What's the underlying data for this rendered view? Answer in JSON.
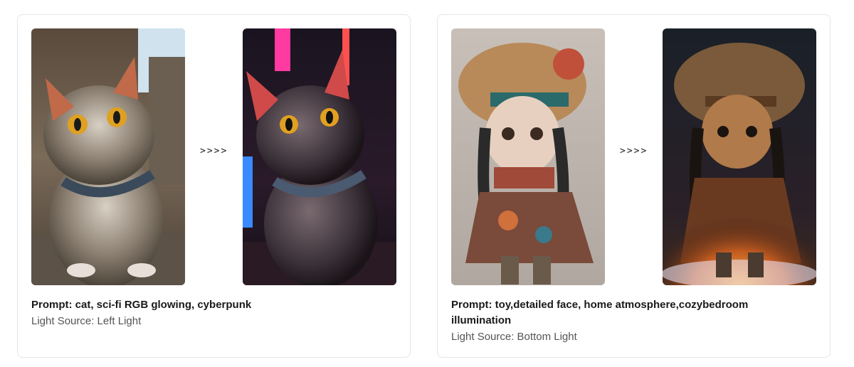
{
  "cards": [
    {
      "arrow": ">>>>",
      "prompt": "Prompt: cat, sci-fi RGB glowing, cyberpunk",
      "light": "Light Source: Left Light",
      "images": [
        "cat-original-photo",
        "cat-relit-cyberpunk"
      ]
    },
    {
      "arrow": ">>>>",
      "prompt": "Prompt: toy,detailed face, home atmosphere,cozybedroom illumination",
      "light": "Light Source: Bottom Light",
      "images": [
        "doll-original-photo",
        "doll-relit-bottom-light"
      ]
    }
  ],
  "colors": {
    "card_border": "#e6e6e6",
    "prompt_text": "#1a1a1a",
    "light_text": "#555555"
  }
}
